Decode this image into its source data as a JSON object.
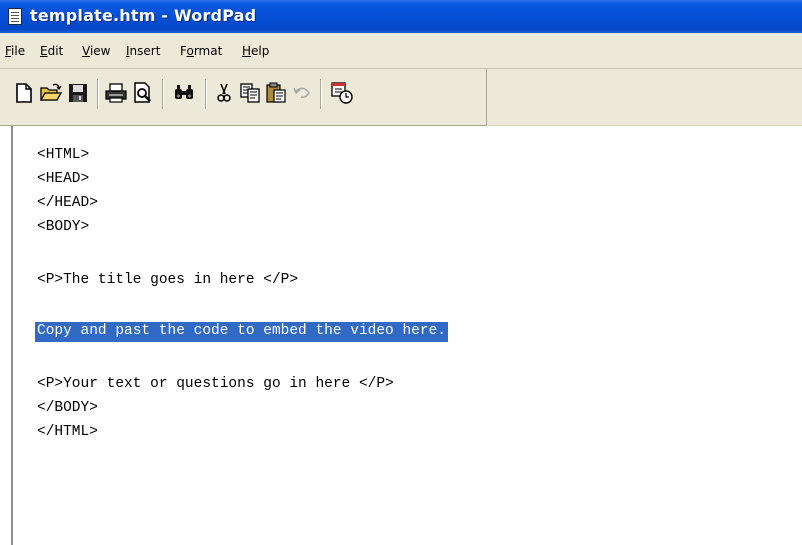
{
  "window": {
    "title": "template.htm - WordPad"
  },
  "menu": {
    "items": [
      {
        "label": "File",
        "accel": "F",
        "rest": "ile"
      },
      {
        "label": "Edit",
        "accel": "E",
        "rest": "dit"
      },
      {
        "label": "View",
        "accel": "V",
        "rest": "iew"
      },
      {
        "label": "Insert",
        "accel": "I",
        "rest": "nsert"
      },
      {
        "label": "Format",
        "accel": "o",
        "pre": "F",
        "rest": "rmat"
      },
      {
        "label": "Help",
        "accel": "H",
        "rest": "elp"
      }
    ]
  },
  "toolbar": {
    "buttons": [
      "new-icon",
      "open-icon",
      "save-icon",
      "print-icon",
      "print-preview-icon",
      "find-icon",
      "cut-icon",
      "copy-icon",
      "paste-icon",
      "undo-icon",
      "insert-datetime-icon"
    ]
  },
  "document": {
    "lines": [
      "<HTML>",
      "<HEAD>",
      "</HEAD>",
      "<BODY>",
      "",
      "<P>The title goes in here </P>",
      "",
      "Copy and past the code to embed the video here.",
      "",
      "<P>Your text or questions go in here </P>",
      "</BODY>",
      "</HTML>"
    ],
    "selected_line_index": 7
  },
  "colors": {
    "titlebar": "#0650d8",
    "selection": "#316ac5",
    "chrome": "#ece9d8"
  }
}
